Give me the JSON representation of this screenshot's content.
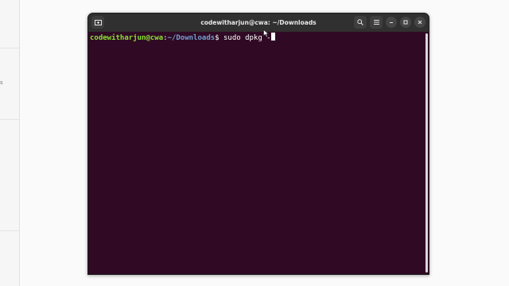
{
  "window": {
    "title": "codewitharjun@cwa: ~/Downloads"
  },
  "titlebar": {
    "new_tab_icon": "new-tab-icon",
    "search_icon": "search-icon",
    "menu_icon": "hamburger-menu-icon",
    "minimize_icon": "minimize-icon",
    "maximize_icon": "maximize-icon",
    "close_icon": "close-icon"
  },
  "terminal": {
    "prompt_user": "codewitharjun@cwa",
    "prompt_sep": ":",
    "prompt_path": "~/Downloads",
    "prompt_symbol": "$",
    "command": " sudo dpkg -"
  },
  "background_window": {
    "glyph": "s"
  },
  "colors": {
    "terminal_bg": "#300a24",
    "titlebar_bg": "#303030",
    "prompt_user": "#8ae234",
    "prompt_path": "#729fcf"
  }
}
